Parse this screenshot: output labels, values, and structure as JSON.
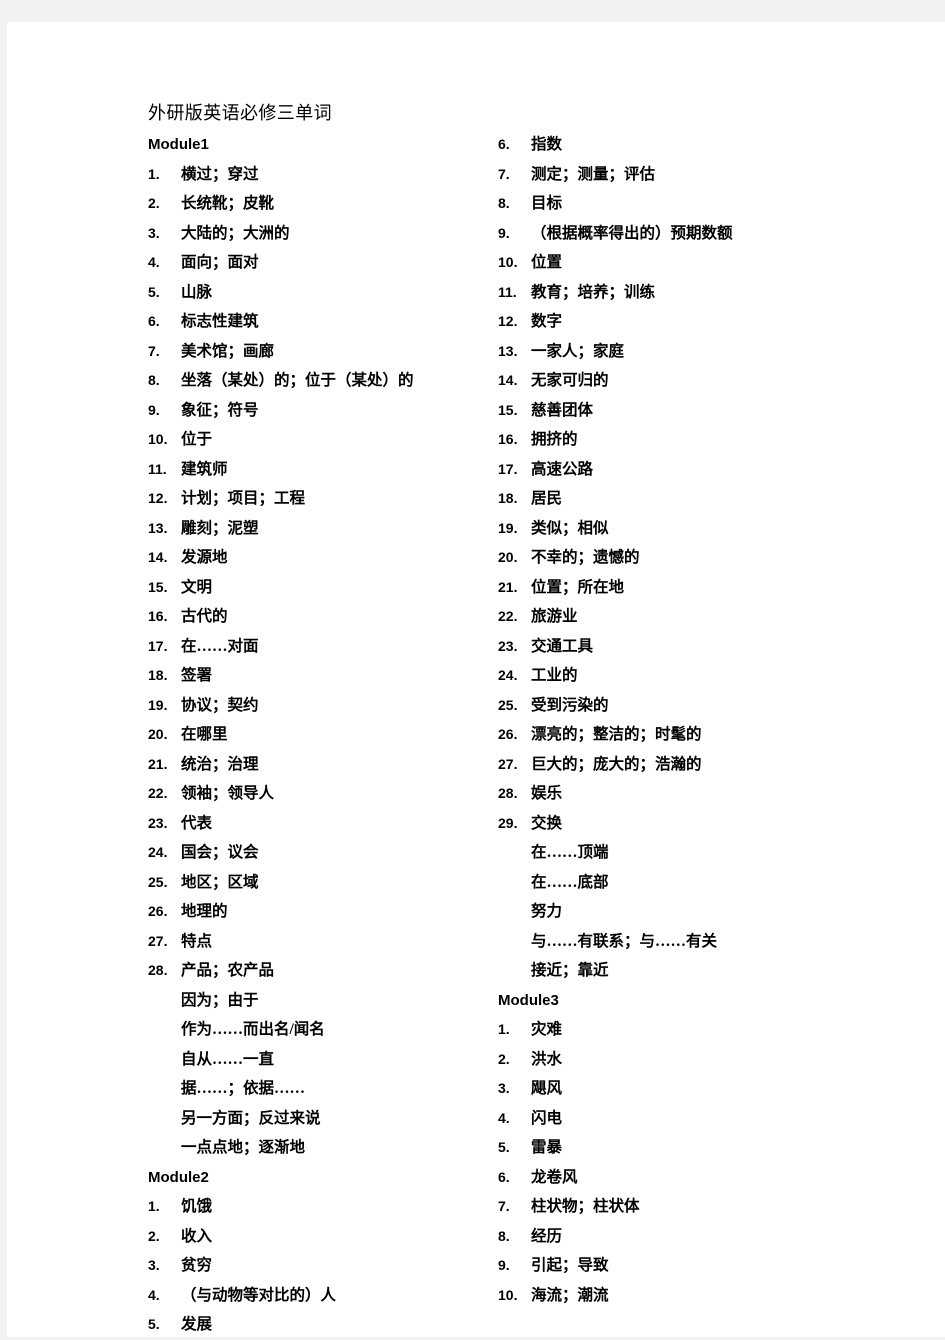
{
  "document": {
    "title": "外研版英语必修三单词"
  },
  "left_column": {
    "blocks": [
      {
        "type": "module",
        "heading": "Module1",
        "items": [
          {
            "num": "1.",
            "text": "横过；穿过"
          },
          {
            "num": "2.",
            "text": "长统靴；皮靴"
          },
          {
            "num": "3.",
            "text": "大陆的；大洲的"
          },
          {
            "num": "4.",
            "text": "面向；面对"
          },
          {
            "num": "5.",
            "text": "山脉"
          },
          {
            "num": "6.",
            "text": "标志性建筑"
          },
          {
            "num": "7.",
            "text": "美术馆；画廊"
          },
          {
            "num": "8.",
            "text": "坐落（某处）的；位于（某处）的"
          },
          {
            "num": "9.",
            "text": "象征；符号"
          },
          {
            "num": "10.",
            "text": "位于"
          },
          {
            "num": "11.",
            "text": "建筑师"
          },
          {
            "num": "12.",
            "text": "计划；项目；工程"
          },
          {
            "num": "13.",
            "text": "雕刻；泥塑"
          },
          {
            "num": "14.",
            "text": "发源地"
          },
          {
            "num": "15.",
            "text": "文明"
          },
          {
            "num": "16.",
            "text": "古代的"
          },
          {
            "num": "17.",
            "text": "在……对面"
          },
          {
            "num": "18.",
            "text": "签署"
          },
          {
            "num": "19.",
            "text": "协议；契约"
          },
          {
            "num": "20.",
            "text": "在哪里"
          },
          {
            "num": "21.",
            "text": "统治；治理"
          },
          {
            "num": "22.",
            "text": "领袖；领导人"
          },
          {
            "num": "23.",
            "text": "代表"
          },
          {
            "num": "24.",
            "text": "国会；议会"
          },
          {
            "num": "25.",
            "text": "地区；区域"
          },
          {
            "num": "26.",
            "text": "地理的"
          },
          {
            "num": "27.",
            "text": "特点"
          },
          {
            "num": "28.",
            "text": "产品；农产品"
          },
          {
            "num": "",
            "text": "因为；由于"
          },
          {
            "num": "",
            "text": "作为……而出名/闻名"
          },
          {
            "num": "",
            "text": "自从……一直"
          },
          {
            "num": "",
            "text": "据……；依据……"
          },
          {
            "num": "",
            "text": "另一方面；反过来说"
          },
          {
            "num": "",
            "text": "一点点地；逐渐地"
          }
        ]
      },
      {
        "type": "module",
        "heading": "Module2",
        "items": [
          {
            "num": "1.",
            "text": "饥饿"
          },
          {
            "num": "2.",
            "text": "收入"
          },
          {
            "num": "3.",
            "text": "贫穷"
          },
          {
            "num": "4.",
            "text": "（与动物等对比的）人"
          },
          {
            "num": "5.",
            "text": "发展"
          }
        ]
      }
    ]
  },
  "right_column": {
    "blocks": [
      {
        "type": "continuation",
        "heading": "",
        "items": [
          {
            "num": "6.",
            "text": "指数"
          },
          {
            "num": "7.",
            "text": "测定；测量；评估"
          },
          {
            "num": "8.",
            "text": "目标"
          },
          {
            "num": "9.",
            "text": "（根据概率得出的）预期数额"
          },
          {
            "num": "10.",
            "text": "位置"
          },
          {
            "num": "11.",
            "text": "教育；培养；训练"
          },
          {
            "num": "12.",
            "text": "数字"
          },
          {
            "num": "13.",
            "text": "一家人；家庭"
          },
          {
            "num": "14.",
            "text": "无家可归的"
          },
          {
            "num": "15.",
            "text": "慈善团体"
          },
          {
            "num": "16.",
            "text": "拥挤的"
          },
          {
            "num": "17.",
            "text": "高速公路"
          },
          {
            "num": "18.",
            "text": "居民"
          },
          {
            "num": "19.",
            "text": "类似；相似"
          },
          {
            "num": "20.",
            "text": "不幸的；遗憾的"
          },
          {
            "num": "21.",
            "text": "位置；所在地"
          },
          {
            "num": "22.",
            "text": "旅游业"
          },
          {
            "num": "23.",
            "text": "交通工具"
          },
          {
            "num": "24.",
            "text": "工业的"
          },
          {
            "num": "25.",
            "text": "受到污染的"
          },
          {
            "num": "26.",
            "text": "漂亮的；整洁的；时髦的"
          },
          {
            "num": "27.",
            "text": "巨大的；庞大的；浩瀚的"
          },
          {
            "num": "28.",
            "text": "娱乐"
          },
          {
            "num": "29.",
            "text": "交换"
          },
          {
            "num": "",
            "text": "在……顶端"
          },
          {
            "num": "",
            "text": "在……底部"
          },
          {
            "num": "",
            "text": "努力"
          },
          {
            "num": "",
            "text": "与……有联系；与……有关"
          },
          {
            "num": "",
            "text": "接近；靠近"
          }
        ]
      },
      {
        "type": "module",
        "heading": "Module3",
        "items": [
          {
            "num": "1.",
            "text": "灾难"
          },
          {
            "num": "2.",
            "text": "洪水"
          },
          {
            "num": "3.",
            "text": "飓风"
          },
          {
            "num": "4.",
            "text": "闪电"
          },
          {
            "num": "5.",
            "text": "雷暴"
          },
          {
            "num": "6.",
            "text": "龙卷风"
          },
          {
            "num": "7.",
            "text": "柱状物；柱状体"
          },
          {
            "num": "8.",
            "text": "经历"
          },
          {
            "num": "9.",
            "text": "引起；导致"
          },
          {
            "num": "10.",
            "text": "海流；潮流"
          }
        ]
      }
    ]
  }
}
